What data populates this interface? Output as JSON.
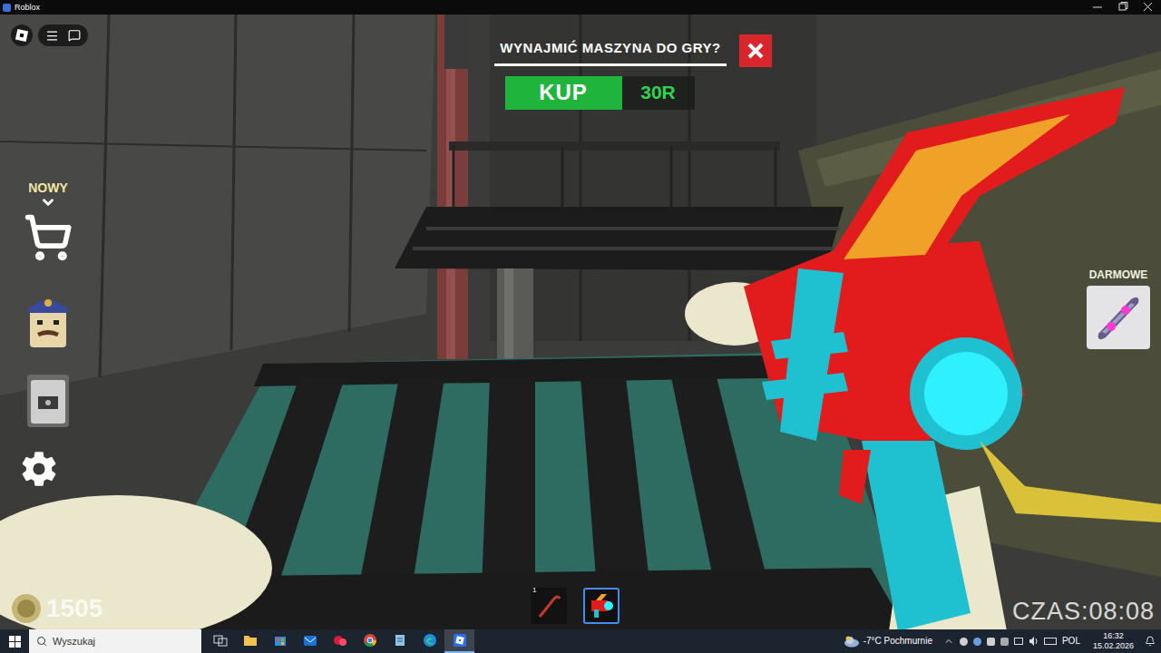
{
  "window": {
    "title": "Roblox"
  },
  "prompt": {
    "question": "WYNAJMIĆ MASZYNA DO GRY?",
    "buy_label": "KUP",
    "price": "30R"
  },
  "left_menu": {
    "badge": "NOWY"
  },
  "free_offer": {
    "label": "DARMOWE"
  },
  "coins": "1505",
  "timer": "CZAS:08:08",
  "hotbar": [
    {
      "number": "1",
      "kind": "crowbar",
      "selected": false
    },
    {
      "number": "",
      "kind": "raygun",
      "selected": true
    }
  ],
  "taskbar": {
    "search_placeholder": "Wyszukaj",
    "apps": [
      {
        "kind": "task-view",
        "selected": false
      },
      {
        "kind": "explorer",
        "selected": false
      },
      {
        "kind": "store",
        "selected": false
      },
      {
        "kind": "mail",
        "selected": false
      },
      {
        "kind": "red-app",
        "selected": false
      },
      {
        "kind": "chrome",
        "selected": false
      },
      {
        "kind": "notes",
        "selected": false
      },
      {
        "kind": "edge",
        "selected": false
      },
      {
        "kind": "roblox",
        "selected": true
      }
    ],
    "weather": "-7°C Pochmurnie",
    "language": "POL",
    "time": "16:32",
    "date": "15.02.2026"
  }
}
